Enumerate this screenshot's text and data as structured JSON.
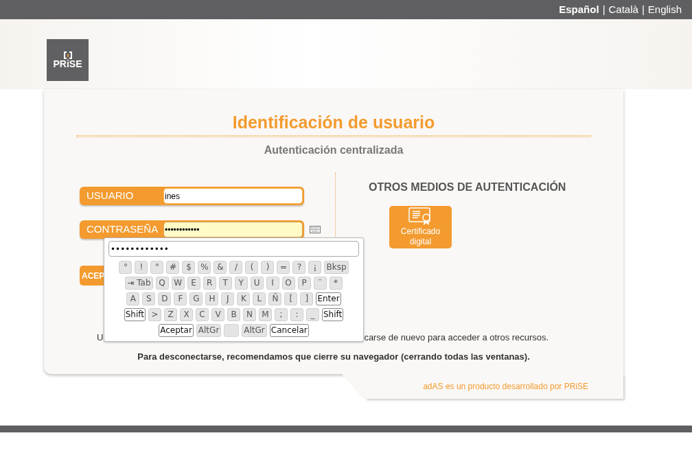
{
  "language_menu": [
    {
      "kind": "link",
      "label": "Español",
      "selected": true
    },
    {
      "kind": "separator",
      "label": "|"
    },
    {
      "kind": "link",
      "label": "Català",
      "selected": false
    },
    {
      "kind": "separator",
      "label": "|"
    },
    {
      "kind": "link",
      "label": "English",
      "selected": false
    }
  ],
  "logo": {
    "text": "PRiSE"
  },
  "title": "Identificación de usuario",
  "subtitle": "Autenticación centralizada",
  "fields": [
    {
      "label": "USUARIO",
      "value": "ines",
      "focused": false,
      "keyboard": false
    },
    {
      "label": "CONTRASEÑA",
      "value": "••••••••••••",
      "focused": true,
      "keyboard": true
    }
  ],
  "submit_button": {
    "label": "ACEP"
  },
  "other_methods": {
    "heading": "OTROS MEDIOS DE AUTENTICACIÓN",
    "buttons": [
      {
        "label": "Certificado digital"
      }
    ]
  },
  "virtual_keyboard": {
    "value": "••••••••••••",
    "rows": [
      {
        "keys": [
          {
            "kind": "key",
            "label": "°"
          },
          {
            "kind": "key",
            "label": "!"
          },
          {
            "kind": "key",
            "label": "\""
          },
          {
            "kind": "key",
            "label": "#"
          },
          {
            "kind": "key",
            "label": "$"
          },
          {
            "kind": "key",
            "label": "%"
          },
          {
            "kind": "key",
            "label": "&"
          },
          {
            "kind": "key",
            "label": "/"
          },
          {
            "kind": "key",
            "label": "("
          },
          {
            "kind": "key",
            "label": ")"
          },
          {
            "kind": "key",
            "label": "="
          },
          {
            "kind": "key",
            "label": "?"
          },
          {
            "kind": "key",
            "label": "¡"
          },
          {
            "kind": "key",
            "label": "Bksp"
          }
        ]
      },
      {
        "keys": [
          {
            "kind": "key",
            "label": "⇥ Tab"
          },
          {
            "kind": "key",
            "label": "Q"
          },
          {
            "kind": "key",
            "label": "W"
          },
          {
            "kind": "key",
            "label": "E"
          },
          {
            "kind": "key",
            "label": "R"
          },
          {
            "kind": "key",
            "label": "T"
          },
          {
            "kind": "key",
            "label": "Y"
          },
          {
            "kind": "key",
            "label": "U"
          },
          {
            "kind": "key",
            "label": "I"
          },
          {
            "kind": "key",
            "label": "O"
          },
          {
            "kind": "key",
            "label": "P"
          },
          {
            "kind": "key",
            "label": "¨"
          },
          {
            "kind": "key",
            "label": "*"
          }
        ]
      },
      {
        "keys": [
          {
            "kind": "key",
            "label": "A"
          },
          {
            "kind": "key",
            "label": "S"
          },
          {
            "kind": "key",
            "label": "D"
          },
          {
            "kind": "key",
            "label": "F"
          },
          {
            "kind": "key",
            "label": "G"
          },
          {
            "kind": "key",
            "label": "H"
          },
          {
            "kind": "key",
            "label": "J"
          },
          {
            "kind": "key",
            "label": "K"
          },
          {
            "kind": "key",
            "label": "L"
          },
          {
            "kind": "key",
            "label": "Ñ"
          },
          {
            "kind": "key",
            "label": "["
          },
          {
            "kind": "key",
            "label": "]"
          },
          {
            "kind": "action",
            "label": "Enter"
          }
        ]
      },
      {
        "keys": [
          {
            "kind": "action",
            "label": "Shift"
          },
          {
            "kind": "key",
            "label": ">"
          },
          {
            "kind": "key",
            "label": "Z"
          },
          {
            "kind": "key",
            "label": "X"
          },
          {
            "kind": "key",
            "label": "C"
          },
          {
            "kind": "key",
            "label": "V"
          },
          {
            "kind": "key",
            "label": "B"
          },
          {
            "kind": "key",
            "label": "N"
          },
          {
            "kind": "key",
            "label": "M"
          },
          {
            "kind": "key",
            "label": ";"
          },
          {
            "kind": "key",
            "label": ":"
          },
          {
            "kind": "key",
            "label": "_"
          },
          {
            "kind": "action",
            "label": "Shift"
          }
        ]
      },
      {
        "keys": [
          {
            "kind": "action",
            "label": "Aceptar"
          },
          {
            "kind": "key",
            "label": "AltGr"
          },
          {
            "kind": "space"
          },
          {
            "kind": "key",
            "label": "AltGr"
          },
          {
            "kind": "action",
            "label": "Cancelar"
          }
        ]
      }
    ]
  },
  "info_text": {
    "line_1_start": "U",
    "line_1_end": "carse de nuevo para acceder a otros recursos.",
    "line_2": "Para desconectarse, recomendamos que cierre su navegador (cerrando todas las ventanas)."
  },
  "footer": "adAS es un producto desarrollado por PRiSE"
}
